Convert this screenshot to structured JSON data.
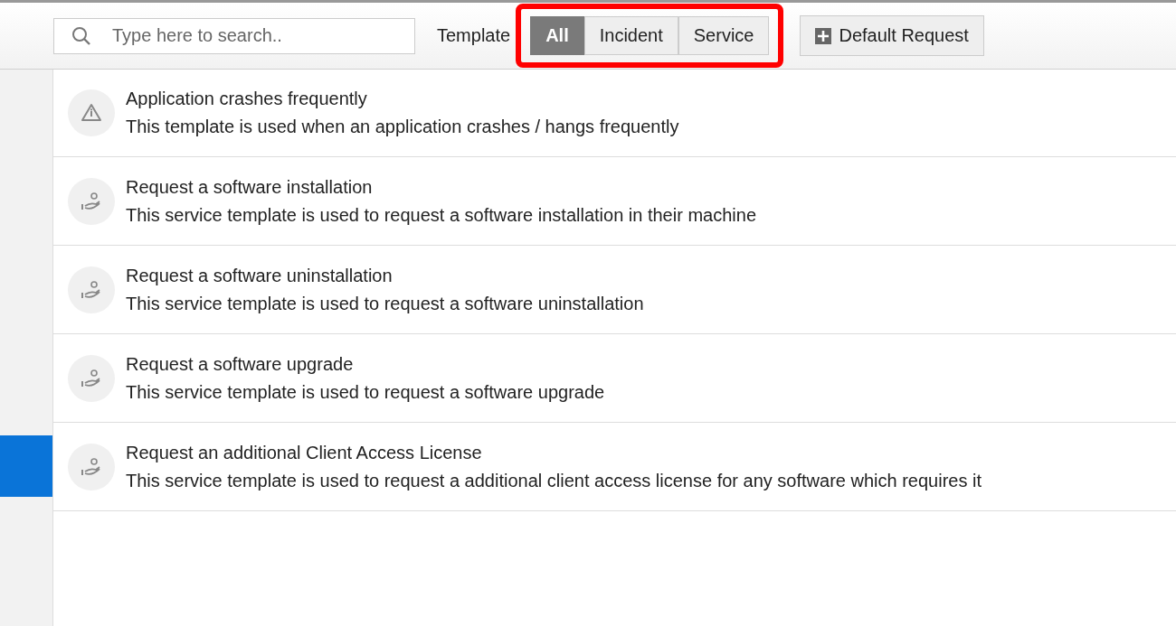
{
  "toolbar": {
    "search": {
      "placeholder": "Type here to search.."
    },
    "template_label": "Template",
    "filters": [
      {
        "label": "All",
        "selected": true
      },
      {
        "label": "Incident",
        "selected": false
      },
      {
        "label": "Service",
        "selected": false
      }
    ],
    "default_request_button": "Default Request"
  },
  "templates": [
    {
      "kind": "incident",
      "title": "Application crashes frequently",
      "description": "This template is used when an application crashes / hangs frequently"
    },
    {
      "kind": "service",
      "title": "Request a software installation",
      "description": "This service template is used to request a software installation in their machine"
    },
    {
      "kind": "service",
      "title": "Request a software uninstallation",
      "description": "This service template is used to request a software uninstallation"
    },
    {
      "kind": "service",
      "title": "Request a software upgrade",
      "description": "This service template is used to request a software upgrade"
    },
    {
      "kind": "service",
      "title": "Request an additional Client Access License",
      "description": "This service template is used to request a additional client access license for any software which requires it"
    }
  ]
}
